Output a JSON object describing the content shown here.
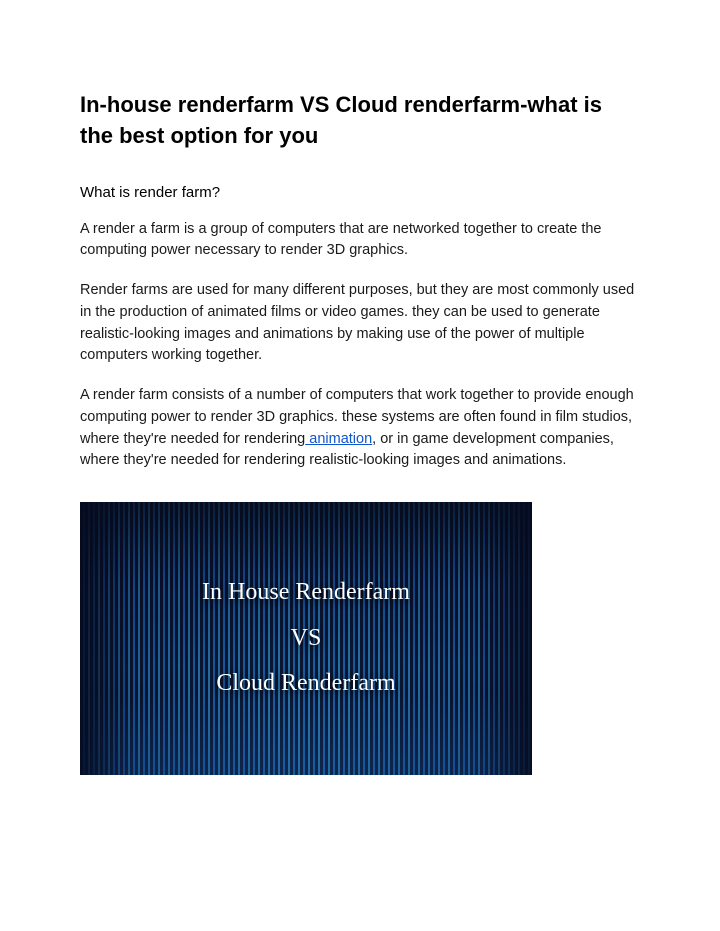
{
  "title": "In-house renderfarm VS Cloud renderfarm-what is the best option for you",
  "subheading": "What is render farm?",
  "paragraphs": {
    "p1": "A render a farm is a group of computers that are networked together to create the computing power necessary to render 3D graphics.",
    "p2": "Render farms are used for many different purposes, but they are most commonly used in the production of animated films or video games. they can be used to generate realistic-looking images and animations by making use of the power of multiple computers working together.",
    "p3_before": "A render farm consists of a number of computers that work together to provide enough computing power to render 3D graphics. these systems are often found in film studios, where they're needed for rendering",
    "p3_link": " animation",
    "p3_after": ", or in game development companies, where they're needed for rendering realistic-looking images and animations."
  },
  "hero": {
    "line1": "In House Renderfarm",
    "line2": "VS",
    "line3": "Cloud Renderfarm"
  }
}
